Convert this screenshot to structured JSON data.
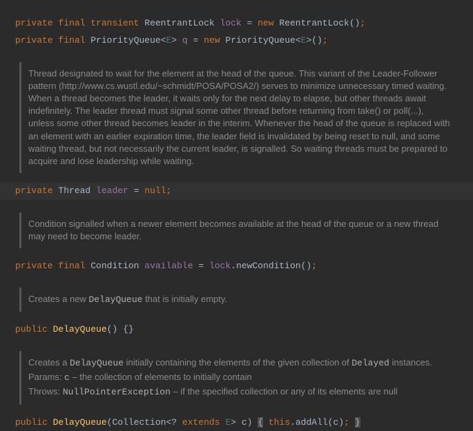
{
  "line1": {
    "kw1": "private",
    "kw2": "final",
    "kw3": "transient",
    "type": "ReentrantLock",
    "field": "lock",
    "eq": "=",
    "newkw": "new",
    "ctor": "ReentrantLock",
    "paren": "()",
    "semi": ";"
  },
  "line2": {
    "kw1": "private",
    "kw2": "final",
    "type": "PriorityQueue",
    "lt": "<",
    "gen": "E",
    "gt": ">",
    "field": "q",
    "eq": "=",
    "newkw": "new",
    "ctor": "PriorityQueue",
    "lt2": "<",
    "gen2": "E",
    "gt2": ">",
    "paren": "()",
    "semi": ";"
  },
  "doc1": "Thread designated to wait for the element at the head of the queue. This variant of the Leader-Follower pattern (http://www.cs.wustl.edu/~schmidt/POSA/POSA2/) serves to minimize unnecessary timed waiting. When a thread becomes the leader, it waits only for the next delay to elapse, but other threads await indefinitely. The leader thread must signal some other thread before returning from take() or poll(...), unless some other thread becomes leader in the interim. Whenever the head of the queue is replaced with an element with an earlier expiration time, the leader field is invalidated by being reset to null, and some waiting thread, but not necessarily the current leader, is signalled. So waiting threads must be prepared to acquire and lose leadership while waiting.",
  "line3": {
    "kw1": "private",
    "type": "Thread",
    "field": "leader",
    "eq": "=",
    "null": "null",
    "semi": ";"
  },
  "doc2": "Condition signalled when a newer element becomes available at the head of the queue or a new thread may need to become leader.",
  "line4": {
    "kw1": "private",
    "kw2": "final",
    "type": "Condition",
    "field": "available",
    "eq": "=",
    "src": "lock",
    "dot": ".",
    "call": "newCondition",
    "paren": "()",
    "semi": ";"
  },
  "doc3": {
    "t1": "Creates a new ",
    "m1": "DelayQueue",
    "t2": " that is initially empty."
  },
  "line5": {
    "kw1": "public",
    "ctor": "DelayQueue",
    "paren": "()",
    "braces": "{}"
  },
  "doc4": {
    "l1a": "Creates a ",
    "l1m": "DelayQueue",
    "l1b": " initially containing the elements of the given collection of ",
    "l1m2": "Delayed",
    "l1c": " instances.",
    "l2a": "Params: ",
    "l2p": "c",
    "l2b": " – the collection of elements to initially contain",
    "l3a": "Throws: ",
    "l3e": "NullPointerException",
    "l3b": " – if the specified collection or any of its elements are null"
  },
  "line6": {
    "kw1": "public",
    "ctor": "DelayQueue",
    "l": "(",
    "ptype": "Collection",
    "lt": "<",
    "q": "?",
    "ext": "extends",
    "gen": "E",
    "gt": ">",
    "pname": "c",
    "r": ")",
    "lb": "{",
    "thiskw": "this",
    "dot": ".",
    "call": "addAll",
    "lp": "(",
    "arg": "c",
    "rp": ")",
    "semi": ";",
    "rb": "}"
  }
}
